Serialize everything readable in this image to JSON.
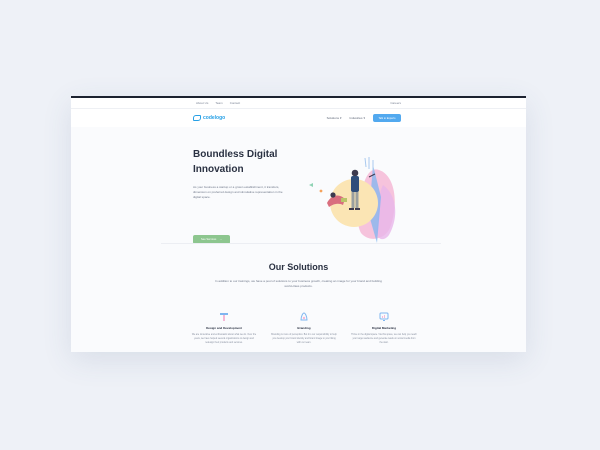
{
  "topbar": {
    "links": [
      "About Us",
      "Team",
      "Contact"
    ],
    "right_link": "Careers"
  },
  "navbar": {
    "logo_text": "codelogo",
    "menu": [
      "Solutions",
      "Industries"
    ],
    "button_label": "Talk to Experts"
  },
  "hero": {
    "title": "Boundless Digital Innovation",
    "description": "As your business a startup or a grown establishment, it transfers, dimension on preferred design and stimulative representation in the digital space.",
    "cta_label": "See Services",
    "cta_arrow": "→"
  },
  "solutions": {
    "title": "Our Solutions",
    "intro": "In addition to our trainings, we have a pool of solutions to your business growth, creating an image for your brand and building world-class products.",
    "cards": [
      {
        "icon": "text-tool-icon",
        "title": "Design and Development",
        "text": "We are innovative and enthusiastic about what we do. Over the years, we have helped several organizations to design and redesign their products and services."
      },
      {
        "icon": "palette-icon",
        "title": "Branding",
        "text": "Branding is more of perception. But it is our responsibility to help you develop your brand identity and brand image to your liking with our team."
      },
      {
        "icon": "monitor-chart-icon",
        "title": "Digital Marketing",
        "text": "Thrive in the digital space. Via this space, we can help you reach your target audience and generate leads on social media from the start."
      }
    ]
  },
  "colors": {
    "accent": "#52a9ef",
    "cta": "#8dc68f",
    "heading": "#2a3142"
  }
}
